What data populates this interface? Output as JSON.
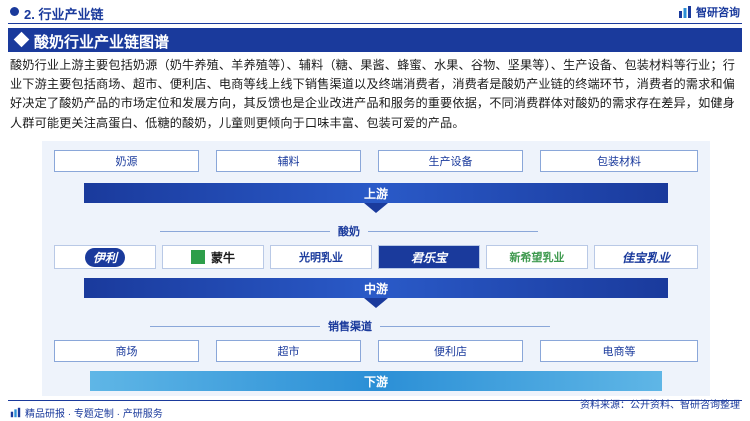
{
  "header": {
    "section_label": "2. 行业产业链",
    "brand_name": "智研咨询",
    "title": "酸奶行业产业链图谱"
  },
  "description": "酸奶行业上游主要包括奶源（奶牛养殖、羊养殖等）、辅料（糖、果酱、蜂蜜、水果、谷物、坚果等）、生产设备、包装材料等行业；行业下游主要包括商场、超市、便利店、电商等线上线下销售渠道以及终端消费者，消费者是酸奶产业链的终端环节，消费者的需求和偏好决定了酸奶产品的市场定位和发展方向，其反馈也是企业改进产品和服务的重要依据，不同消费群体对酸奶的需求存在差异，如健身人群可能更关注高蛋白、低糖的酸奶，儿童则更倾向于口味丰富、包装可爱的产品。",
  "upstream": {
    "items": [
      "奶源",
      "辅料",
      "生产设备",
      "包装材料"
    ],
    "band_label": "上游"
  },
  "midstream": {
    "sub_label": "酸奶",
    "logos": [
      "伊利",
      "蒙牛",
      "光明乳业",
      "君乐宝",
      "新希望乳业",
      "佳宝乳业"
    ],
    "band_label": "中游"
  },
  "downstream": {
    "sub_label": "销售渠道",
    "items": [
      "商场",
      "超市",
      "便利店",
      "电商等"
    ],
    "band_label": "下游"
  },
  "footer": {
    "left_text": "精品研报 · 专题定制 · 产研服务",
    "source": "资料来源：公开资料、智研咨询整理"
  },
  "colors": {
    "primary": "#1a3a9c",
    "light_band": "#2b8fd6",
    "panel": "#eef3fb"
  }
}
